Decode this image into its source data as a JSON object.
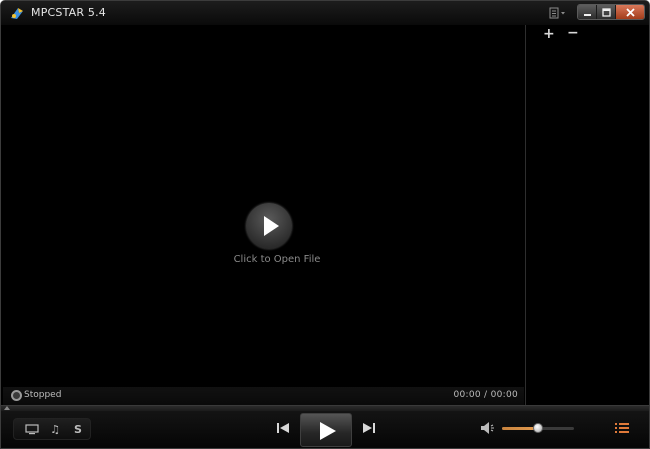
{
  "titlebar": {
    "title": "MPCSTAR 5.4",
    "icons": [
      "app-logo-icon",
      "menu-icon",
      "minimize-icon",
      "maximize-icon",
      "close-icon"
    ]
  },
  "video": {
    "open_file_label": "Click to Open File",
    "icon": "play-icon"
  },
  "playlist": {
    "add_label": "+",
    "remove_label": "−"
  },
  "status": {
    "state": "Stopped",
    "current_time": "00:00",
    "separator": "/",
    "total_time": "00:00"
  },
  "controls": {
    "mode_buttons": [
      {
        "id": "video",
        "icon": "screen-icon"
      },
      {
        "id": "audio",
        "icon": "music-note-icon",
        "label": "♫"
      },
      {
        "id": "s",
        "label": "S"
      }
    ],
    "icons": [
      "previous-icon",
      "play-icon",
      "next-icon",
      "volume-icon",
      "playlist-icon"
    ],
    "volume_level": 0.5
  },
  "colors": {
    "background": "#000000",
    "accent_orange": "#e07a3a",
    "close_button": "#c0502a",
    "text": "#bdbdbd"
  }
}
